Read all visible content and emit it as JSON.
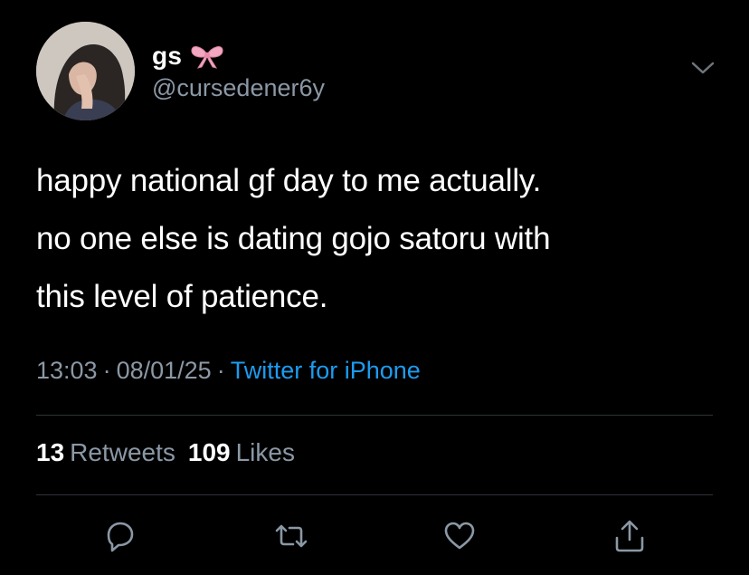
{
  "author": {
    "display_name": "gs",
    "emoji": "bow-icon",
    "handle": "@cursedener6y",
    "avatar": "avatar"
  },
  "tweet": {
    "lines": [
      "happy national gf day to me actually.",
      "no one else is dating gojo satoru with",
      "this level of patience."
    ]
  },
  "meta": {
    "time": "13:03",
    "separator": "·",
    "date": "08/01/25",
    "source": "Twitter for iPhone"
  },
  "stats": {
    "retweets_count": "13",
    "retweets_label": "Retweets",
    "likes_count": "109",
    "likes_label": "Likes"
  },
  "actions": [
    "reply-icon",
    "retweet-icon",
    "like-icon",
    "share-icon"
  ],
  "colors": {
    "background": "#000000",
    "text": "#ffffff",
    "secondary": "#8b98a5",
    "link": "#1d9bf0",
    "divider": "#2f3336",
    "bow": "#f4a7c0"
  }
}
